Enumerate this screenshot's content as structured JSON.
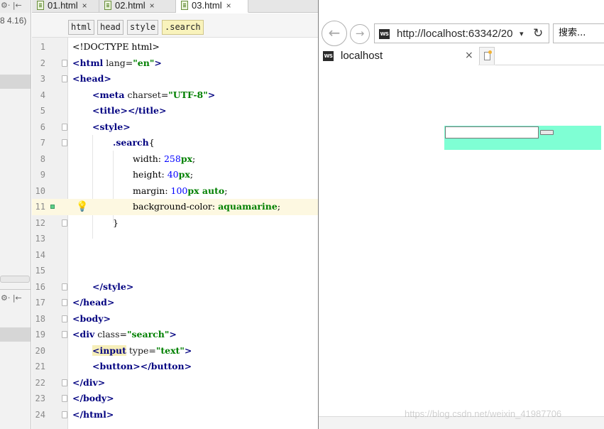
{
  "left_panel": {
    "tools_icons": "⚙· |←",
    "version": "8 4.16)",
    "tools_icons_2": "⚙· |←"
  },
  "editor": {
    "tabs": [
      {
        "label": "01.html",
        "active": false
      },
      {
        "label": "02.html",
        "active": false
      },
      {
        "label": "03.html",
        "active": true
      }
    ],
    "tab_close": "×",
    "breadcrumbs": [
      "html",
      "head",
      "style",
      ".search"
    ],
    "line_numbers": [
      "1",
      "2",
      "3",
      "4",
      "5",
      "6",
      "7",
      "8",
      "9",
      "10",
      "11",
      "12",
      "13",
      "14",
      "15",
      "16",
      "17",
      "18",
      "19",
      "20",
      "21",
      "22",
      "23",
      "24"
    ],
    "current_line": "11",
    "code": {
      "l1": "<!DOCTYPE html>",
      "l2_tag": "<html",
      "l2_attr": " lang=",
      "l2_val": "\"en\"",
      "l2_end": ">",
      "l3": "<head>",
      "l4_tag": "<meta",
      "l4_attr": " charset=",
      "l4_val": "\"UTF-8\"",
      "l4_end": ">",
      "l5": "<title></title>",
      "l6": "<style>",
      "l7_sel": ".search",
      "l7_brace": "{",
      "l8_prop": "width: ",
      "l8_num": "258",
      "l8_unit": "px",
      "l8_end": ";",
      "l9_prop": "height: ",
      "l9_num": "40",
      "l9_unit": "px",
      "l9_end": ";",
      "l10_prop": "margin: ",
      "l10_num": "100",
      "l10_unit": "px auto",
      "l10_end": ";",
      "l11_prop": "background-color: ",
      "l11_val": "aquamarine",
      "l11_end": ";",
      "l12": "}",
      "l16": "</style>",
      "l17": "</head>",
      "l18": "<body>",
      "l19_tag": "<div",
      "l19_attr": " class=",
      "l19_val": "\"search\"",
      "l19_end": ">",
      "l20_tag": "<input",
      "l20_attr": " type=",
      "l20_val": "\"text\"",
      "l20_end": ">",
      "l21": "<button></button>",
      "l22": "</div>",
      "l23": "</body>",
      "l24": "</html>"
    }
  },
  "browser": {
    "back_icon": "←",
    "forward_icon": "→",
    "favicon_text": "WS",
    "url": "http://localhost:63342/20",
    "dropdown_icon": "▾",
    "refresh_icon": "↻",
    "search_placeholder": "搜索...",
    "tab_title": "localhost",
    "tab_close": "×",
    "page": {
      "div_background": "#7fffd4",
      "input_value": ""
    }
  },
  "watermark": "https://blog.csdn.net/weixin_41987706"
}
